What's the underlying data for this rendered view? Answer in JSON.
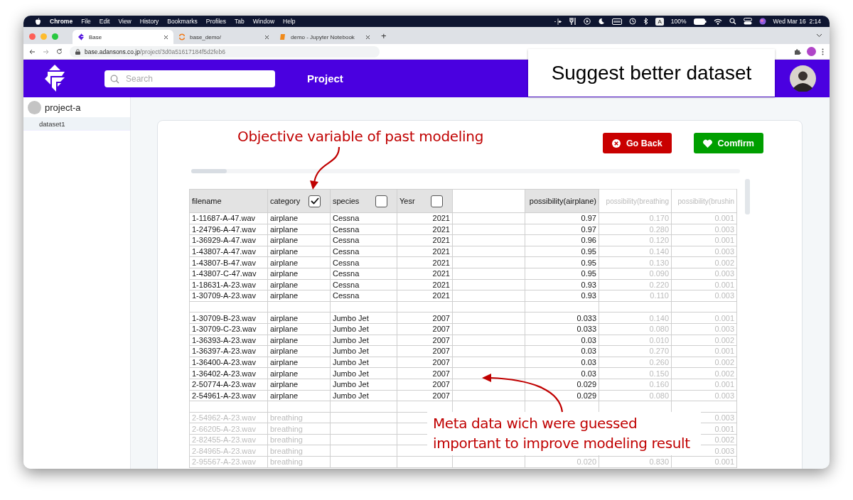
{
  "menubar": {
    "app": "Chrome",
    "menus": [
      "File",
      "Edit",
      "View",
      "History",
      "Bookmarks",
      "Profiles",
      "Tab",
      "Window",
      "Help"
    ],
    "input_source": "A",
    "battery": "100%",
    "clock": "Wed Mar 16  2:14"
  },
  "browser_tabs": [
    {
      "title": "Base",
      "kind": "app",
      "selected": true
    },
    {
      "title": "base_demo/",
      "kind": "loading",
      "selected": false
    },
    {
      "title": "demo - Jupyter Notebook",
      "kind": "notebook",
      "selected": false
    }
  ],
  "new_tab": "+",
  "address": {
    "host": "base.adansons.co.jp",
    "path": "/project/3d0a51617184f5d2feb6"
  },
  "header": {
    "search_placeholder": "Search",
    "title": "Project"
  },
  "sidebar": {
    "project": "project-a",
    "items": [
      {
        "label": "dataset1",
        "selected": true
      }
    ]
  },
  "slide_title": "Suggest better dataset",
  "callouts": {
    "objective": "Objective variable of past modeling",
    "meta": [
      "Meta data wich were guessed",
      "important to improve modeling result"
    ]
  },
  "buttons": [
    {
      "label": "Go Back",
      "kind": "cancel"
    },
    {
      "label": "Comfirm",
      "kind": "confirm"
    }
  ],
  "table": {
    "columns": [
      {
        "label": "filename",
        "kind": "text",
        "shaded": true,
        "dimmed": false
      },
      {
        "label": "category",
        "kind": "text",
        "shaded": true,
        "dimmed": false,
        "checked": true
      },
      {
        "label": "species",
        "kind": "text",
        "shaded": true,
        "dimmed": false,
        "checked": false
      },
      {
        "label": "Yesr",
        "kind": "number",
        "shaded": true,
        "dimmed": false,
        "checked": false
      },
      {
        "kind": "spacer",
        "shaded": false,
        "dimmed": false
      },
      {
        "label": "possibility(airplane)",
        "kind": "number",
        "shaded": true,
        "dimmed": false
      },
      {
        "label": "possibility(breathing",
        "kind": "number",
        "shaded": false,
        "dimmed": true
      },
      {
        "label": "possibility(brushin",
        "kind": "number",
        "shaded": false,
        "dimmed": true
      }
    ],
    "rows": [
      {
        "kind": "data",
        "dimmed": false,
        "cells": [
          "1-11687-A-47.wav",
          "airplane",
          "Cessna",
          "2021",
          null,
          "0.97",
          "0.170",
          "0.001"
        ]
      },
      {
        "kind": "data",
        "dimmed": false,
        "cells": [
          "1-24796-A-47.wav",
          "airplane",
          "Cessna",
          "2021",
          null,
          "0.97",
          "0.280",
          "0.003"
        ]
      },
      {
        "kind": "data",
        "dimmed": false,
        "cells": [
          "1-36929-A-47.wav",
          "airplane",
          "Cessna",
          "2021",
          null,
          "0.96",
          "0.120",
          "0.001"
        ]
      },
      {
        "kind": "data",
        "dimmed": false,
        "cells": [
          "1-43807-A-47.wav",
          "airplane",
          "Cessna",
          "2021",
          null,
          "0.95",
          "0.140",
          "0.003"
        ]
      },
      {
        "kind": "data",
        "dimmed": false,
        "cells": [
          "1-43807-B-47.wav",
          "airplane",
          "Cessna",
          "2021",
          null,
          "0.95",
          "0.130",
          "0.002"
        ]
      },
      {
        "kind": "data",
        "dimmed": false,
        "cells": [
          "1-43807-C-47.wav",
          "airplane",
          "Cessna",
          "2021",
          null,
          "0.95",
          "0.090",
          "0.003"
        ]
      },
      {
        "kind": "data",
        "dimmed": false,
        "cells": [
          "1-18631-A-23.wav",
          "airplane",
          "Cessna",
          "2021",
          null,
          "0.93",
          "0.220",
          "0.001"
        ]
      },
      {
        "kind": "data",
        "dimmed": false,
        "cells": [
          "1-30709-A-23.wav",
          "airplane",
          "Cessna",
          "2021",
          null,
          "0.93",
          "0.110",
          "0.003"
        ]
      },
      {
        "kind": "gap"
      },
      {
        "kind": "data",
        "dimmed": false,
        "cells": [
          "1-30709-B-23.wav",
          "airplane",
          "Jumbo Jet",
          "2007",
          null,
          "0.033",
          "0.140",
          "0.001"
        ]
      },
      {
        "kind": "data",
        "dimmed": false,
        "cells": [
          "1-30709-C-23.wav",
          "airplane",
          "Jumbo Jet",
          "2007",
          null,
          "0.033",
          "0.080",
          "0.003"
        ]
      },
      {
        "kind": "data",
        "dimmed": false,
        "cells": [
          "1-36393-A-23.wav",
          "airplane",
          "Jumbo Jet",
          "2007",
          null,
          "0.03",
          "0.010",
          "0.002"
        ]
      },
      {
        "kind": "data",
        "dimmed": false,
        "cells": [
          "1-36397-A-23.wav",
          "airplane",
          "Jumbo Jet",
          "2007",
          null,
          "0.03",
          "0.270",
          "0.001"
        ]
      },
      {
        "kind": "data",
        "dimmed": false,
        "cells": [
          "1-36400-A-23.wav",
          "airplane",
          "Jumbo Jet",
          "2007",
          null,
          "0.03",
          "0.260",
          "0.002"
        ]
      },
      {
        "kind": "data",
        "dimmed": false,
        "cells": [
          "1-36402-A-23.wav",
          "airplane",
          "Jumbo Jet",
          "2007",
          null,
          "0.03",
          "0.150",
          "0.002"
        ]
      },
      {
        "kind": "data",
        "dimmed": false,
        "cells": [
          "2-50774-A-23.wav",
          "airplane",
          "Jumbo Jet",
          "2007",
          null,
          "0.029",
          "0.160",
          "0.001"
        ]
      },
      {
        "kind": "data",
        "dimmed": false,
        "cells": [
          "2-54961-A-23.wav",
          "airplane",
          "Jumbo Jet",
          "2007",
          null,
          "0.029",
          "0.080",
          "0.003"
        ]
      },
      {
        "kind": "gap"
      },
      {
        "kind": "data",
        "dimmed": true,
        "cells": [
          "2-54962-A-23.wav",
          "breathing",
          null,
          null,
          null,
          null,
          null,
          "0.003"
        ]
      },
      {
        "kind": "data",
        "dimmed": true,
        "cells": [
          "2-66205-A-23.wav",
          "breathing",
          null,
          null,
          null,
          null,
          null,
          "0.001"
        ]
      },
      {
        "kind": "data",
        "dimmed": true,
        "cells": [
          "2-82455-A-23.wav",
          "breathing",
          null,
          null,
          null,
          null,
          null,
          "0.002"
        ]
      },
      {
        "kind": "data",
        "dimmed": true,
        "cells": [
          "2-84965-A-23.wav",
          "breathing",
          null,
          null,
          null,
          null,
          null,
          "0.003"
        ]
      },
      {
        "kind": "data",
        "dimmed": true,
        "cells": [
          "2-95567-A-23.wav",
          "breathing",
          null,
          null,
          null,
          "0.020",
          "0.830",
          "0.001"
        ]
      }
    ]
  }
}
